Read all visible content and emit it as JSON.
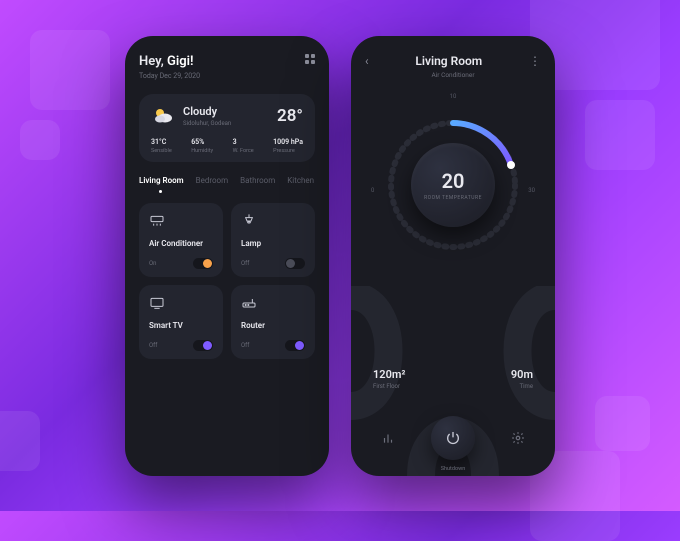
{
  "colors": {
    "accent_purple": "#7e5bff",
    "accent_orange": "#f8a24b",
    "accent_blue": "#5aa9ff"
  },
  "home": {
    "greeting_prefix": "Hey, ",
    "greeting_name": "Gigi!",
    "date": "Today Dec 29, 2020",
    "weather": {
      "condition": "Cloudy",
      "location": "Sidoluhur, Godean",
      "temperature": "28°",
      "stats": [
        {
          "value": "31°C",
          "label": "Sensible"
        },
        {
          "value": "65%",
          "label": "Humidity"
        },
        {
          "value": "3",
          "label": "W. Force"
        },
        {
          "value": "1009 hPa",
          "label": "Pressure"
        }
      ]
    },
    "tabs": [
      "Living Room",
      "Bedroom",
      "Bathroom",
      "Kitchen"
    ],
    "active_tab": 0,
    "devices": [
      {
        "name": "Air Conditioner",
        "state": "On",
        "on": true,
        "knob": "#f8a24b",
        "icon": "ac"
      },
      {
        "name": "Lamp",
        "state": "Off",
        "on": false,
        "knob": "#4a4c58",
        "icon": "lamp"
      },
      {
        "name": "Smart TV",
        "state": "Off",
        "on": true,
        "knob": "#7e5bff",
        "icon": "tv"
      },
      {
        "name": "Router",
        "state": "Off",
        "on": true,
        "knob": "#7e5bff",
        "icon": "router"
      }
    ]
  },
  "room": {
    "title": "Living Room",
    "subtitle": "Air Conditioner",
    "dial_ticks": {
      "min": "0",
      "mid": "10",
      "max": "30"
    },
    "temperature_value": "20",
    "temperature_label": "ROOM\nTEMPERATURE",
    "stats": [
      {
        "value": "120m²",
        "label": "First Floor"
      },
      {
        "value": "90m",
        "label": "Time"
      }
    ],
    "shutdown_label": "Shutdown"
  }
}
